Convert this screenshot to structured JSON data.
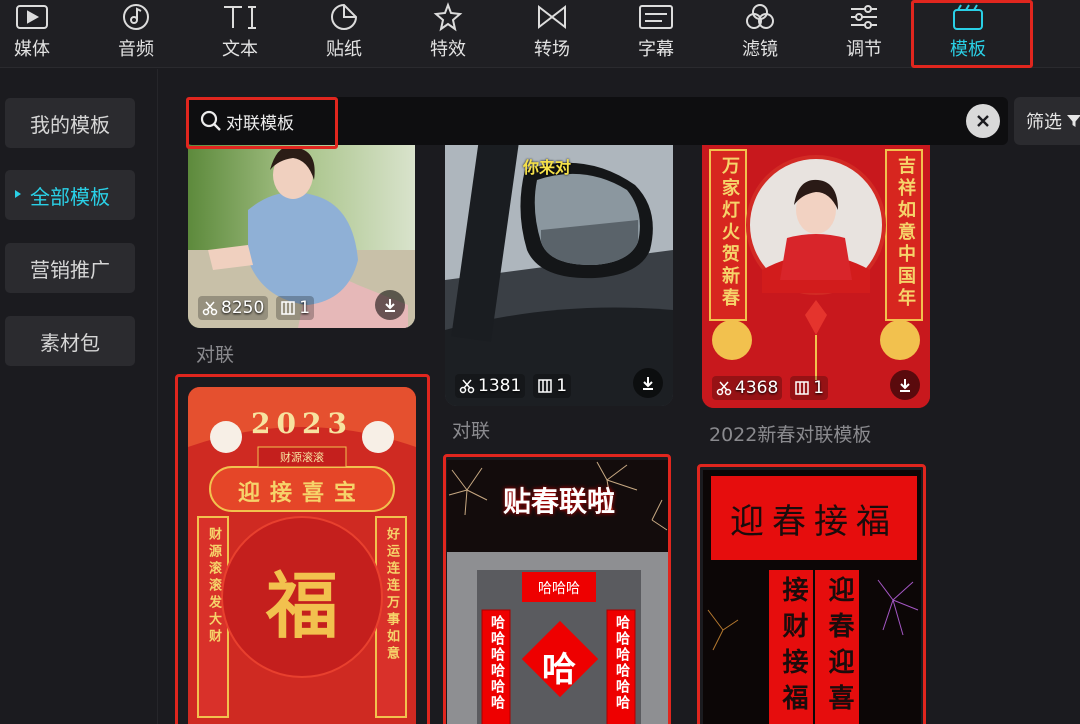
{
  "toolbar": {
    "tabs": [
      {
        "label": "媒体",
        "icon": "media-icon"
      },
      {
        "label": "音频",
        "icon": "audio-icon"
      },
      {
        "label": "文本",
        "icon": "text-icon"
      },
      {
        "label": "贴纸",
        "icon": "sticker-icon"
      },
      {
        "label": "特效",
        "icon": "effects-icon"
      },
      {
        "label": "转场",
        "icon": "transition-icon"
      },
      {
        "label": "字幕",
        "icon": "subtitle-icon"
      },
      {
        "label": "滤镜",
        "icon": "filter-icon"
      },
      {
        "label": "调节",
        "icon": "adjust-icon"
      },
      {
        "label": "模板",
        "icon": "template-icon",
        "active": true
      }
    ],
    "accent_color": "#2ad0e6",
    "highlight_color": "#e0261e"
  },
  "sidebar": {
    "items": [
      {
        "label": "我的模板"
      },
      {
        "label": "全部模板",
        "active": true
      },
      {
        "label": "营销推广"
      },
      {
        "label": "素材包"
      }
    ]
  },
  "search": {
    "value": "对联模板",
    "clear_icon": "close-icon"
  },
  "filter": {
    "label": "筛选",
    "icon": "funnel-icon"
  },
  "cards": [
    {
      "title": "对联",
      "uses": "8250",
      "clips": "1"
    },
    {
      "title": "对联",
      "uses": "1381",
      "clips": "1",
      "caption": "你来对"
    },
    {
      "title": "2022新春对联模板",
      "uses": "4368",
      "clips": "1",
      "couplet_left": "万家灯火贺新春",
      "couplet_right": "吉祥如意中国年"
    },
    {
      "year": "2023",
      "banner": "财源滚滚",
      "header": "迎接喜宝",
      "center": "福",
      "couplet_left": "财源滚滚发大财",
      "couplet_right": "好运连连万事如意"
    },
    {
      "headline": "贴春联啦",
      "door_top": "哈哈哈",
      "door_center": "哈",
      "door_left": "哈哈哈哈哈哈",
      "door_right": "哈哈哈哈哈哈"
    },
    {
      "header": "迎春接福",
      "couplet_left": "接财接福",
      "couplet_right": "迎春迎喜"
    }
  ]
}
